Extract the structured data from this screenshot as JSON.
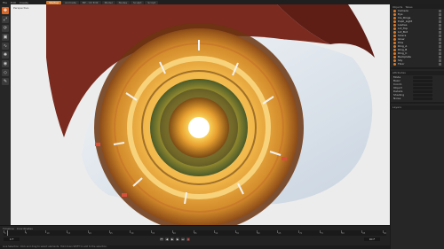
{
  "menu": [
    "File",
    "Edit",
    "Create",
    "Modes",
    "Select",
    "Tools",
    "Mesh",
    "Spline",
    "Volumes",
    "MoGraph",
    "Character",
    "Animate",
    "Simulate",
    "Tracker",
    "Render",
    "Extensions",
    "Window",
    "Help"
  ],
  "modes": [
    {
      "label": "Startup",
      "active": true
    },
    {
      "label": "Animate",
      "active": false
    },
    {
      "label": "BP - UV Edit",
      "active": false
    },
    {
      "label": "Model",
      "active": false
    },
    {
      "label": "Nodes",
      "active": false
    },
    {
      "label": "Sculpt",
      "active": false
    },
    {
      "label": "Script",
      "active": false
    }
  ],
  "toolbar_icons": [
    "move-icon",
    "scale-icon",
    "rotate-icon",
    "cube-icon",
    "spline-icon",
    "light-icon",
    "camera-icon",
    "deformer-icon",
    "brush-icon"
  ],
  "viewport": {
    "label": "Perspective"
  },
  "panel": {
    "tabs": [
      "Objects",
      "Takes"
    ],
    "objects": [
      "Camera",
      "Eye",
      "Iris_Rings",
      "Pupil_Light",
      "Lashes",
      "Lid_Top",
      "Lid_Bot",
      "Sclera",
      "Glow",
      "Pins",
      "Ring_A",
      "Ring_B",
      "Ring_C",
      "Backplate",
      "Sky",
      "Floor"
    ],
    "attr_tab": "Attributes",
    "attributes": [
      "Mode",
      "Basic",
      "Coord.",
      "Object",
      "Details",
      "Shading",
      "Noise"
    ],
    "layer_tab": "Layers"
  },
  "timeline": {
    "tabs": [
      "Timeline",
      "Coordinates"
    ],
    "ticks": [
      "0",
      "5",
      "10",
      "15",
      "20",
      "25",
      "30",
      "35",
      "40",
      "45",
      "50",
      "55",
      "60",
      "65",
      "70",
      "75",
      "80",
      "85",
      "90"
    ],
    "current_frame": "0 F",
    "end_frame": "90 F",
    "status": "Live Selection: Click and drag to select elements. Hold down SHIFT to add to the selection."
  },
  "colors": {
    "accent": "#d8682a",
    "iris_glow": "#ffd966",
    "skin": "#7a2a1e",
    "sclera": "#e8eef4"
  }
}
